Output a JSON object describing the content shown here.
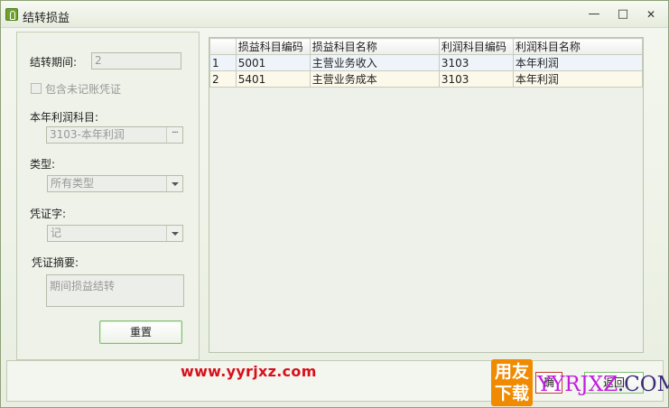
{
  "window": {
    "title": "结转损益",
    "minimize_glyph": "—",
    "maximize_glyph": "□",
    "close_glyph": "✕"
  },
  "form": {
    "period_label": "结转期间:",
    "period_value": "2",
    "include_unposted_label": "包含未记账凭证",
    "include_unposted_checked": false,
    "profit_account_label": "本年利润科目:",
    "profit_account_value": "3103-本年利润",
    "browse_label": "···",
    "type_label": "类型:",
    "type_value": "所有类型",
    "voucher_word_label": "凭证字:",
    "voucher_word_value": "记",
    "summary_label": "凭证摘要:",
    "summary_value": "期间损益结转",
    "reset_button": "重置"
  },
  "grid": {
    "columns": [
      "",
      "损益科目编码",
      "损益科目名称",
      "利润科目编码",
      "利润科目名称"
    ],
    "rows": [
      [
        "1",
        "5001",
        "主营业务收入",
        "3103",
        "本年利润"
      ],
      [
        "2",
        "5401",
        "主营业务成本",
        "3103",
        "本年利润"
      ]
    ]
  },
  "footer": {
    "watermark_url": "www.yyrjxz.com",
    "logo_line1": "用友",
    "logo_line2": "下载",
    "ok_button_partial": "确",
    "cancel_button_partial": "返回",
    "watermark_brand_a": "YYRJXZ",
    "watermark_brand_b": ".COM"
  },
  "colors": {
    "accent_green": "#7fc06e",
    "watermark_red": "#d7101b",
    "logo_orange": "#f08a00",
    "brand_magenta": "#c21de0"
  }
}
